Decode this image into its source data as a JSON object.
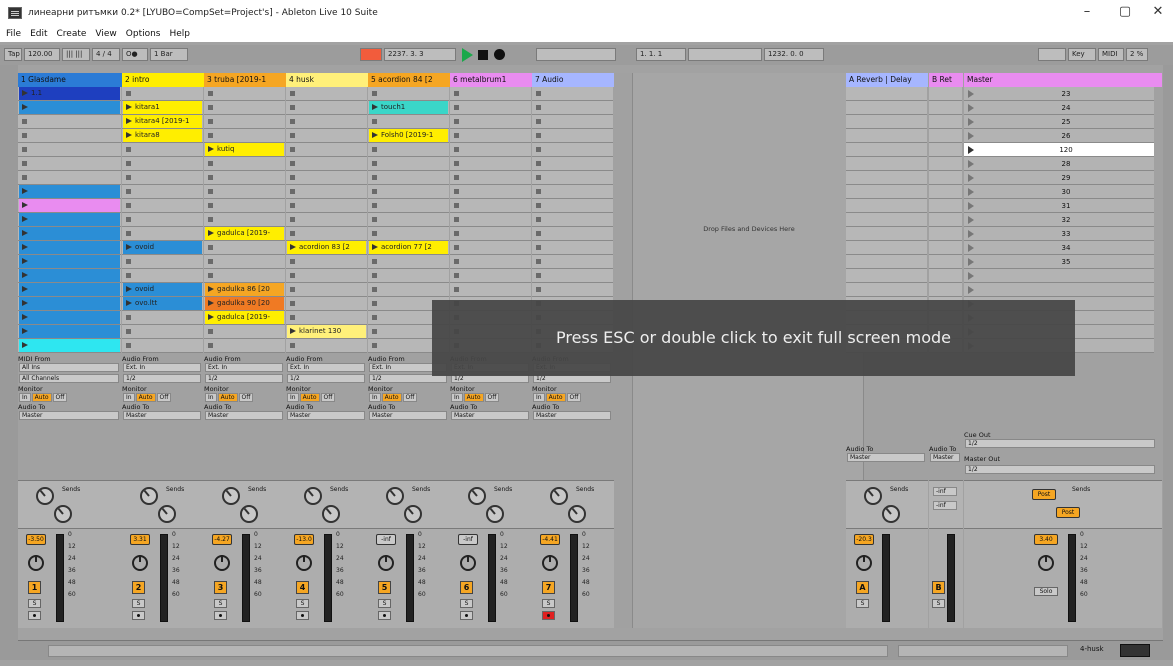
{
  "window": {
    "title": "линеарни ритъмки 0.2* [LYUBO=CompSet=Project's] - Ableton Live 10 Suite",
    "minimize": "–",
    "maximize": "▢",
    "close": "✕"
  },
  "menu": [
    "File",
    "Edit",
    "Create",
    "View",
    "Options",
    "Help"
  ],
  "control_bar": {
    "tap": "Tap",
    "tempo": "120.00",
    "nudge": "|||  |||",
    "signature": "4 / 4",
    "metronome": "O●",
    "quantize": "1 Bar",
    "arrangement_position": "2237.  3.  3",
    "loop_start": "1.  1.  1",
    "loop_length": "1232.  0.  0",
    "key": "Key",
    "midi": "MIDI",
    "cpu": "2 %"
  },
  "tracks": [
    {
      "name": "1 Glasdame",
      "color": "#2b7bd6",
      "input_label": "MIDI From",
      "input": "All Ins",
      "channel": "All Channels",
      "volume": "-3.50",
      "number": "1"
    },
    {
      "name": "2 intro",
      "color": "#ffee00",
      "input_label": "Audio From",
      "input": "Ext. In",
      "channel": "1/2",
      "volume": "3.31",
      "number": "2"
    },
    {
      "name": "3 truba [2019-1",
      "color": "#f5a623",
      "input_label": "Audio From",
      "input": "Ext. In",
      "channel": "1/2",
      "volume": "-4.27",
      "number": "3"
    },
    {
      "name": "4 husk",
      "color": "#fff07a",
      "input_label": "Audio From",
      "input": "Ext. In",
      "channel": "1/2",
      "volume": "-13.0",
      "number": "4"
    },
    {
      "name": "5 acordion 84 [2",
      "color": "#f5a623",
      "input_label": "Audio From",
      "input": "Ext. In",
      "channel": "1/2",
      "volume": "-inf",
      "number": "5"
    },
    {
      "name": "6 metalbrum1",
      "color": "#e98cf0",
      "input_label": "Audio From",
      "input": "Ext. In",
      "channel": "1/2",
      "volume": "-inf",
      "number": "6"
    },
    {
      "name": "7 Audio",
      "color": "#a6b6ff",
      "input_label": "Audio From",
      "input": "Ext. In",
      "channel": "1/2",
      "volume": "-4.41",
      "number": "7"
    }
  ],
  "clips": {
    "t1": [
      "1.1",
      "",
      "",
      "",
      "",
      "",
      "",
      "",
      "",
      "",
      "",
      "",
      "",
      "",
      "",
      "",
      "",
      "",
      ""
    ],
    "t2": [
      "",
      "kitara1",
      "kitara4 [2019-1",
      "kitara8",
      "",
      "",
      "",
      "",
      "",
      "",
      "",
      "",
      "",
      "",
      "",
      "",
      "",
      "",
      ""
    ],
    "t2b": {
      "r12": "ovoid",
      "r15": "ovoid",
      "r16": "ovo.ltt"
    },
    "t3": {
      "r5": "kutiq",
      "r11": "gadulca [2019-",
      "r15": "gadulka 86 [20",
      "r16": "gadulka 90 [20",
      "r17": "gadulca [2019-"
    },
    "t4": {
      "r12": "acordion 83 [2",
      "r18": "klarinet 130"
    },
    "t5": {
      "r2": "touch1",
      "r4": "Folsh0 [2019-1",
      "r12": "acordion 77 [2"
    }
  },
  "scenes": [
    "23",
    "24",
    "25",
    "26",
    "120",
    "28",
    "29",
    "30",
    "31",
    "32",
    "33",
    "34",
    "35"
  ],
  "monitor": {
    "label": "Monitor",
    "in": "In",
    "auto": "Auto",
    "off": "Off"
  },
  "audio_to": {
    "label": "Audio To",
    "value": "Master"
  },
  "sends_label": "Sends",
  "meter_scale": [
    "0",
    "12",
    "24",
    "36",
    "48",
    "60"
  ],
  "solo_btn": "S",
  "drop_text": "Drop Files and Devices Here",
  "returns": [
    {
      "name": "A Reverb | Delay",
      "color": "#a6b6ff",
      "volume": "-20.3",
      "letter": "A"
    },
    {
      "name": "B Ret",
      "color": "#e98cf0",
      "volume": "",
      "letter": "B"
    }
  ],
  "master": {
    "name": "Master",
    "color": "#e98cf0",
    "volume": "3.40",
    "cue_out": "Cue Out",
    "cue_value": "1/2",
    "master_out": "Master Out",
    "master_value": "1/2",
    "post": "Post",
    "solo": "Solo"
  },
  "return_sends": [
    "-inf",
    "-inf"
  ],
  "status": {
    "track": "4-husk"
  },
  "overlay": "Press ESC or double  click to exit full screen mode"
}
